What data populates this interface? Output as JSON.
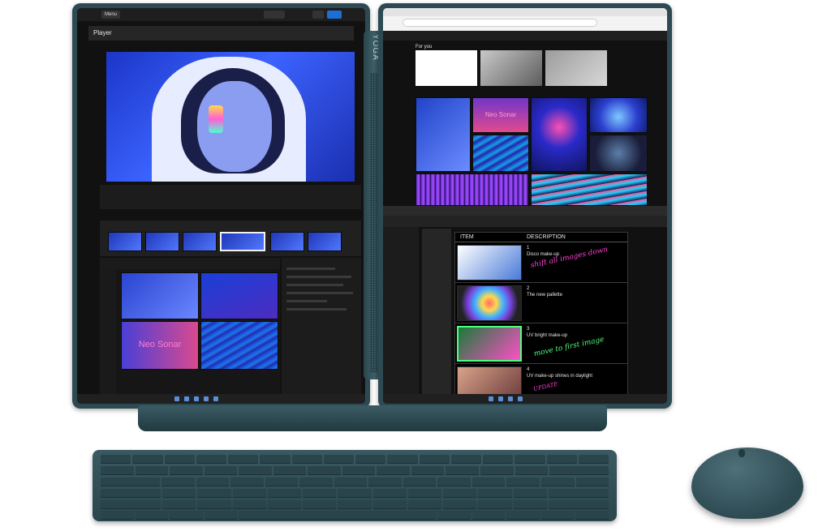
{
  "left_screen": {
    "menu_chip": "Menu",
    "player_title": "Player",
    "neo_sonar": "Neo Sonar"
  },
  "hinge": {
    "brand": "YOGA"
  },
  "right_screen": {
    "for_you": "For you",
    "neo_sonar": "Neo Sonar",
    "table": {
      "headers": [
        "ITEM",
        "DESCRIPTION"
      ],
      "rows": [
        {
          "num": "1",
          "desc": "Disco make-up"
        },
        {
          "num": "2",
          "desc": "The new pallette"
        },
        {
          "num": "3",
          "desc": "UV bright make-up"
        },
        {
          "num": "4",
          "desc": "UV make-up shines in daylight"
        }
      ]
    },
    "annotations": {
      "shift": "shift all images down",
      "move": "move to first image",
      "update": "UPDATE"
    }
  },
  "colors": {
    "device": "#2d4a52",
    "ink_pink": "#ff3fd6",
    "ink_green": "#4cff7c"
  }
}
